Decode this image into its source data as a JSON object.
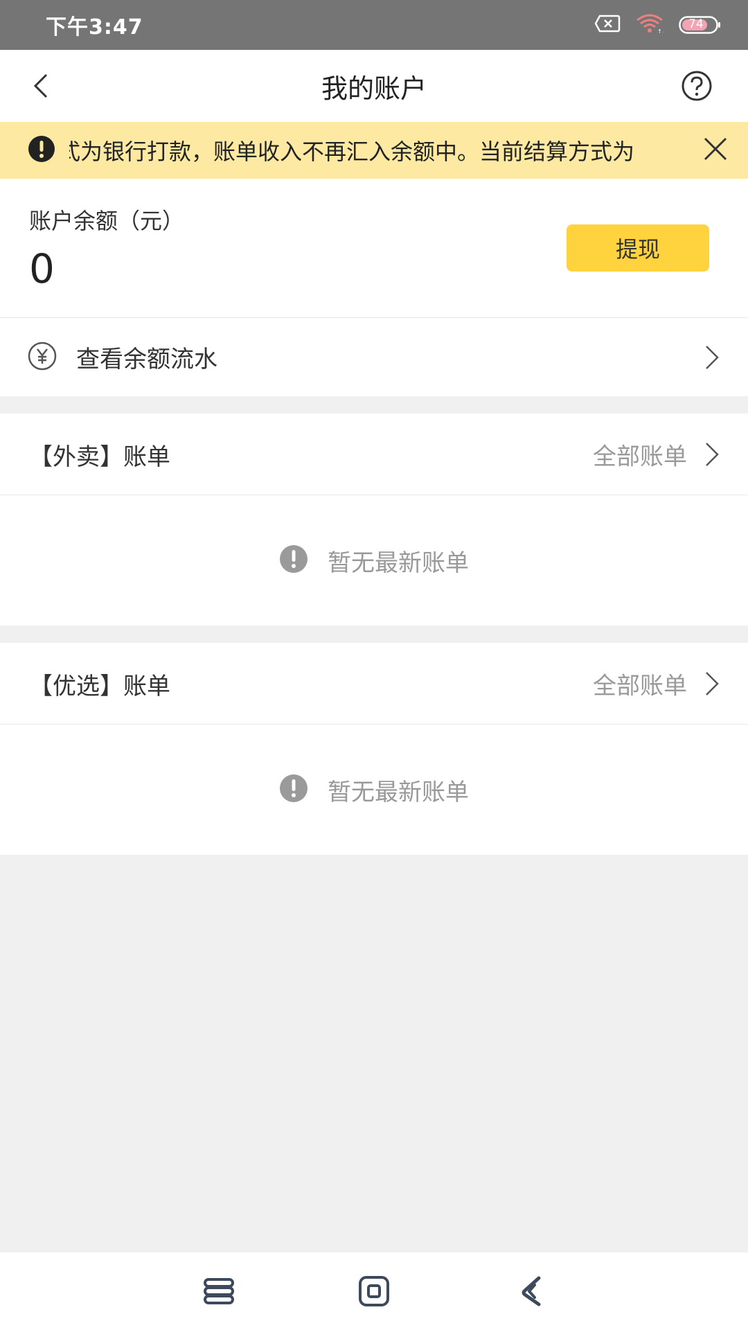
{
  "status_bar": {
    "time": "下午3:47",
    "battery": "74",
    "icons": [
      "sim-error-icon",
      "wifi-icon",
      "battery-icon"
    ]
  },
  "header": {
    "title": "我的账户",
    "back_icon": "chevron-left-icon",
    "help_icon": "question-circle-icon"
  },
  "notice": {
    "text": "式为银行打款，账单收入不再汇入余额中。当前结算方式为",
    "icon": "exclamation-circle-icon",
    "close_icon": "close-icon",
    "background": "#fde9a2"
  },
  "balance": {
    "label": "账户余额（元）",
    "value": "0",
    "withdraw_label": "提现",
    "accent": "#ffd33d"
  },
  "flow": {
    "label": "查看余额流水",
    "icon": "yen-circle-icon"
  },
  "sections": [
    {
      "title": "【外卖】账单",
      "all_label": "全部账单",
      "empty_text": "暂无最新账单"
    },
    {
      "title": "【优选】账单",
      "all_label": "全部账单",
      "empty_text": "暂无最新账单"
    }
  ],
  "system_nav": [
    "menu-icon",
    "home-icon",
    "back-icon"
  ]
}
